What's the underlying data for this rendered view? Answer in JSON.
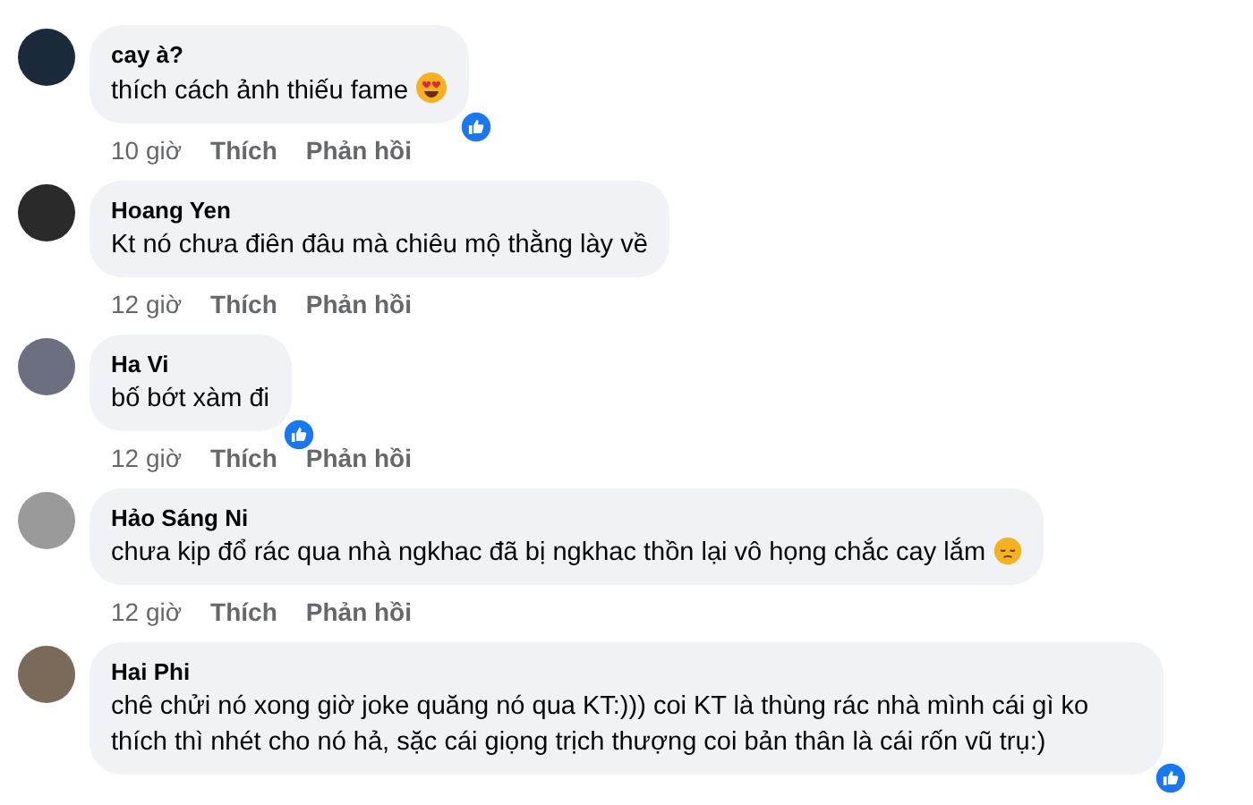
{
  "comments": [
    {
      "author": "cay à?",
      "text": "thích cách ảnh thiếu fame",
      "emoji": {
        "kind": "heart-eyes"
      },
      "time": "10 giờ",
      "like": "Thích",
      "reply": "Phản hồi",
      "reacted": true
    },
    {
      "author": "Hoang Yen",
      "text": "Kt nó chưa điên đâu mà chiêu mộ thằng lày về",
      "time": "12 giờ",
      "like": "Thích",
      "reply": "Phản hồi",
      "reacted": false
    },
    {
      "author": "Ha Vi",
      "text": "bố bớt xàm đi",
      "time": "12 giờ",
      "like": "Thích",
      "reply": "Phản hồi",
      "reacted": true
    },
    {
      "author": "Hảo Sáng Ni",
      "text": "chưa kịp đổ rác qua nhà ngkhac đã bị ngkhac thồn lại vô họng chắc cay lắm",
      "emoji": {
        "kind": "pensive"
      },
      "time": "12 giờ",
      "like": "Thích",
      "reply": "Phản hồi",
      "reacted": false
    },
    {
      "author": "Hai Phi",
      "text": "chê chửi nó xong giờ joke quăng nó qua KT:))) coi KT là thùng rác nhà mình cái gì ko thích thì nhét cho nó hả, sặc cái giọng trịch thượng coi bản thân là cái rốn vũ trụ:)",
      "reacted": true
    }
  ]
}
